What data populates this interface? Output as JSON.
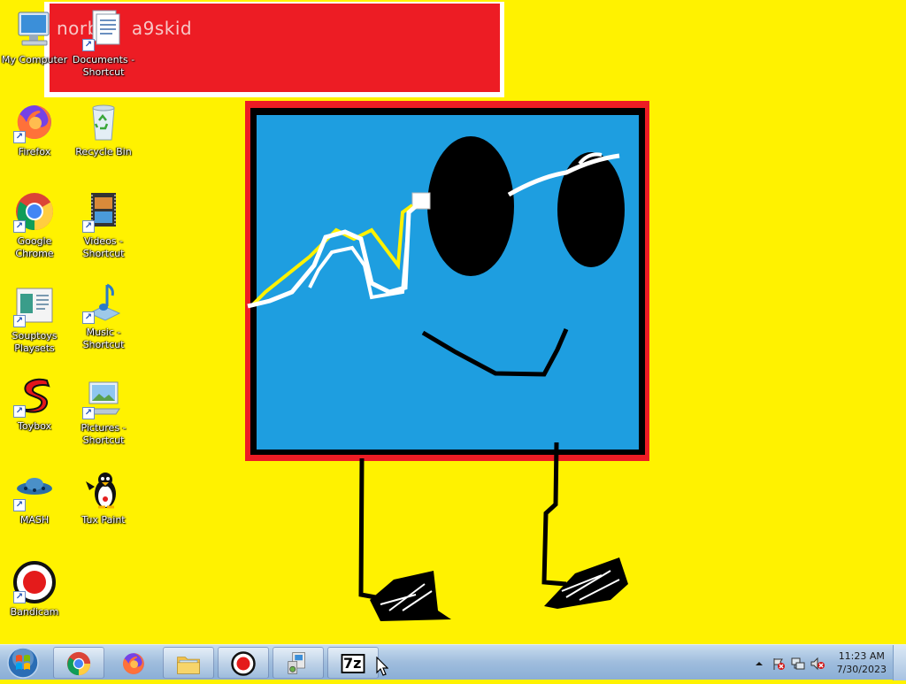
{
  "wallpaper": {
    "background": "#fff200",
    "banner_text": "norb",
    "banner_text_tail": "a9skid",
    "colors": {
      "red": "#ed1c24",
      "blue": "#1e9ee0",
      "black": "#000000",
      "white": "#ffffff"
    }
  },
  "desktop_icons": [
    {
      "label": "My Computer",
      "icon": "computer-icon"
    },
    {
      "label": "Documents - Shortcut",
      "icon": "documents-icon"
    },
    {
      "label": "Firefox",
      "icon": "firefox-icon"
    },
    {
      "label": "Recycle Bin",
      "icon": "recycle-bin-icon"
    },
    {
      "label": "Google Chrome",
      "icon": "chrome-icon"
    },
    {
      "label": "Videos - Shortcut",
      "icon": "videos-icon"
    },
    {
      "label": "Souptoys Playsets",
      "icon": "souptoys-icon"
    },
    {
      "label": "Music - Shortcut",
      "icon": "music-icon"
    },
    {
      "label": "Toybox",
      "icon": "toybox-icon"
    },
    {
      "label": "Pictures - Shortcut",
      "icon": "pictures-icon"
    },
    {
      "label": "MASH",
      "icon": "mash-icon"
    },
    {
      "label": "Tux Paint",
      "icon": "tux-paint-icon"
    },
    {
      "label": "Bandicam",
      "icon": "bandicam-icon"
    }
  ],
  "taskbar": {
    "start_icon": "windows-orb-icon",
    "pinned": [
      {
        "name": "Google Chrome",
        "icon": "chrome-icon"
      },
      {
        "name": "Firefox",
        "icon": "firefox-icon"
      },
      {
        "name": "Windows Explorer",
        "icon": "folder-icon"
      },
      {
        "name": "Bandicam",
        "icon": "bandicam-icon"
      },
      {
        "name": "Control Panel",
        "icon": "control-panel-icon"
      },
      {
        "name": "7-Zip",
        "icon": "7zip-icon",
        "text": "7z"
      }
    ],
    "tray": {
      "icons": [
        "show-hidden-icons-icon",
        "action-center-flag-icon",
        "network-icon",
        "volume-muted-icon"
      ],
      "time": "11:23 AM",
      "date": "7/30/2023"
    }
  }
}
